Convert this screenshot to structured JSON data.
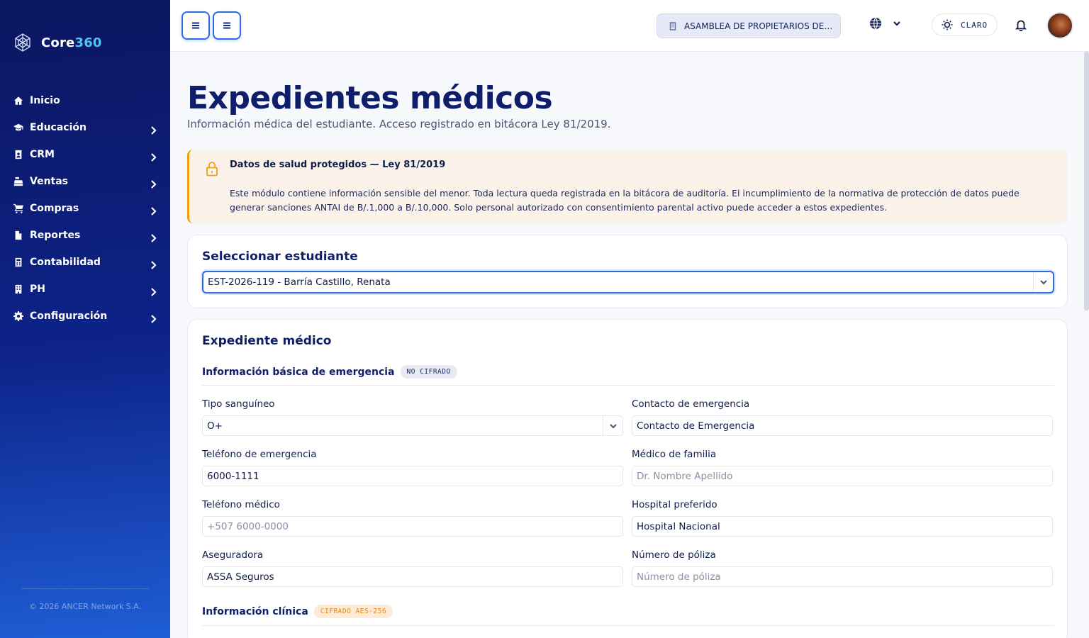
{
  "brand": {
    "name_part1": "Core",
    "name_part2": "360"
  },
  "sidebar": {
    "items": [
      {
        "label": "Inicio",
        "icon": "home-icon"
      },
      {
        "label": "Educación",
        "icon": "graduation-cap-icon"
      },
      {
        "label": "CRM",
        "icon": "address-book-icon"
      },
      {
        "label": "Ventas",
        "icon": "cash-register-icon"
      },
      {
        "label": "Compras",
        "icon": "shopping-cart-icon"
      },
      {
        "label": "Reportes",
        "icon": "file-report-icon"
      },
      {
        "label": "Contabilidad",
        "icon": "calculator-icon"
      },
      {
        "label": "PH",
        "icon": "building-icon"
      },
      {
        "label": "Configuración",
        "icon": "gear-icon"
      }
    ],
    "copyright": "© 2026 ANCER Network S.A."
  },
  "topbar": {
    "organization": "ASAMBLEA DE PROPIETARIOS DE ...",
    "theme_label": "CLARO"
  },
  "page": {
    "title": "Expedientes médicos",
    "subtitle": "Información médica del estudiante. Acceso registrado en bitácora Ley 81/2019."
  },
  "alert": {
    "title": "Datos de salud protegidos — Ley 81/2019",
    "body": "Este módulo contiene información sensible del menor. Toda lectura queda registrada en la bitácora de auditoría. El incumplimiento de la normativa de protección de datos puede generar sanciones ANTAI de B/.1,000 a B/.10,000. Solo personal autorizado con consentimiento parental activo puede acceder a estos expedientes."
  },
  "student_select": {
    "title": "Seleccionar estudiante",
    "value": "EST-2026-119 - Barría Castillo, Renata"
  },
  "record": {
    "title": "Expediente médico",
    "section_basic": {
      "title": "Información básica de emergencia",
      "badge": "NO CIFRADO"
    },
    "section_clinical": {
      "title": "Información clínica",
      "badge": "CIFRADO AES-256"
    },
    "fields": {
      "blood_type": {
        "label": "Tipo sanguíneo",
        "value": "O+"
      },
      "emergency_contact": {
        "label": "Contacto de emergencia",
        "value": "Contacto de Emergencia"
      },
      "emergency_phone": {
        "label": "Teléfono de emergencia",
        "value": "6000-1111"
      },
      "family_doctor": {
        "label": "Médico de familia",
        "value": "",
        "placeholder": "Dr. Nombre Apellido"
      },
      "medical_phone": {
        "label": "Teléfono médico",
        "value": "",
        "placeholder": "+507 6000-0000"
      },
      "preferred_hospital": {
        "label": "Hospital preferido",
        "value": "Hospital Nacional"
      },
      "insurer": {
        "label": "Aseguradora",
        "value": "ASSA Seguros"
      },
      "policy_number": {
        "label": "Número de póliza",
        "value": "",
        "placeholder": "Número de póliza"
      }
    }
  },
  "colors": {
    "accent": "#2b6be6",
    "navy": "#0f1e6a",
    "warning": "#f59e0b"
  }
}
